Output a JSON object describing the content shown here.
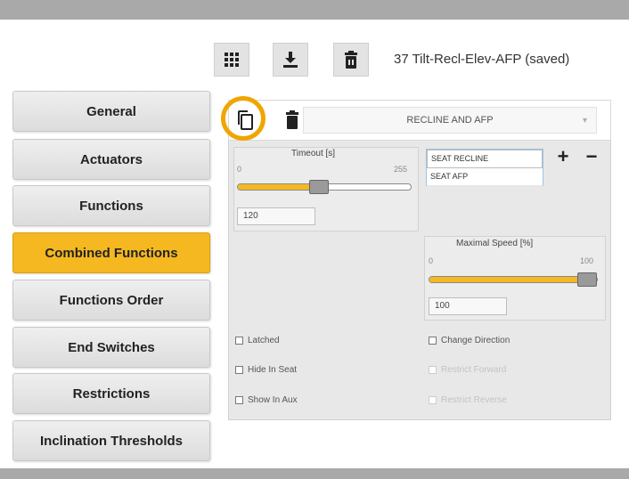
{
  "toolbar": {
    "title": "37 Tilt-Recl-Elev-AFP (saved)",
    "buttons": [
      {
        "name": "grid-menu-icon"
      },
      {
        "name": "download-icon"
      },
      {
        "name": "trash-icon"
      }
    ]
  },
  "tabs": [
    {
      "label": "General",
      "active": false
    },
    {
      "label": "Actuators",
      "active": false
    },
    {
      "label": "Functions",
      "active": false
    },
    {
      "label": "Combined Functions",
      "active": true
    },
    {
      "label": "Functions Order",
      "active": false
    },
    {
      "label": "End Switches",
      "active": false
    },
    {
      "label": "Restrictions",
      "active": false
    },
    {
      "label": "Inclination Thresholds",
      "active": false
    }
  ],
  "panel": {
    "selected_function": "RECLINE AND AFP",
    "timeout": {
      "label": "Timeout  [s]",
      "min": "0",
      "max": "255",
      "value": "120",
      "fraction": 0.47
    },
    "functions_list": [
      "SEAT RECLINE",
      "SEAT AFP"
    ],
    "add_symbol": "+",
    "remove_symbol": "−",
    "max_speed": {
      "label": "Maximal Speed  [%]",
      "min": "0",
      "max": "100",
      "value": "100",
      "fraction": 1.0
    },
    "checkboxes": {
      "latched": "Latched",
      "hide_in_seat": "Hide In Seat",
      "show_in_aux": "Show In Aux",
      "change_direction": "Change Direction",
      "restrict_forward": "Restrict Forward",
      "restrict_reverse": "Restrict Reverse"
    }
  },
  "colors": {
    "accent": "#f5b821",
    "highlight_ring": "#f0a500",
    "frame_bar": "#a9a9a9"
  }
}
